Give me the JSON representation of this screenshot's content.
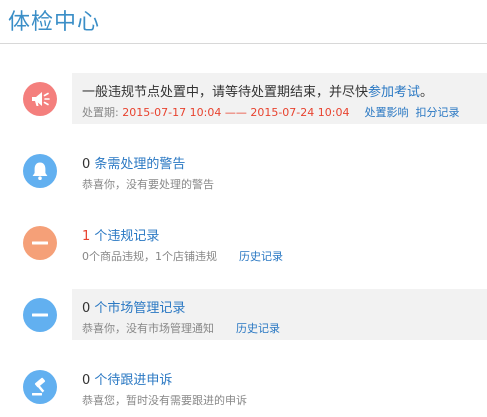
{
  "header": {
    "title": "体检中心"
  },
  "colors": {
    "title_blue": "#3a8ec7",
    "link_blue": "#2a78c3",
    "alert_red": "#e8432f",
    "icon_pink": "#f47f7d",
    "icon_blue": "#62b0f0",
    "icon_orange": "#f5a078"
  },
  "items": [
    {
      "icon": "megaphone-icon",
      "title_text": "一般违规节点处置中，请等待处置期结束，并尽快",
      "title_link": "参加考试",
      "title_end": "。",
      "period_label": "处置期:",
      "period_start": "2015-07-17 10:04",
      "period_sep": "——",
      "period_end": "2015-07-24 10:04",
      "links": [
        "处置影响",
        "扣分记录"
      ]
    },
    {
      "icon": "bell-icon",
      "count": "0",
      "title_link": "条需处理的警告",
      "subtitle": "恭喜你，没有要处理的警告"
    },
    {
      "icon": "minus-icon",
      "count": "1",
      "title_link": "个违规记录",
      "subtitle": "0个商品违规，1个店铺违规",
      "link": "历史记录"
    },
    {
      "icon": "minus-icon",
      "count": "0",
      "title_link": "个市场管理记录",
      "subtitle": "恭喜你，没有市场管理通知",
      "link": "历史记录"
    },
    {
      "icon": "gavel-icon",
      "count": "0",
      "title_link": "个待跟进申诉",
      "subtitle": "恭喜您，暂时没有需要跟进的申诉"
    }
  ]
}
